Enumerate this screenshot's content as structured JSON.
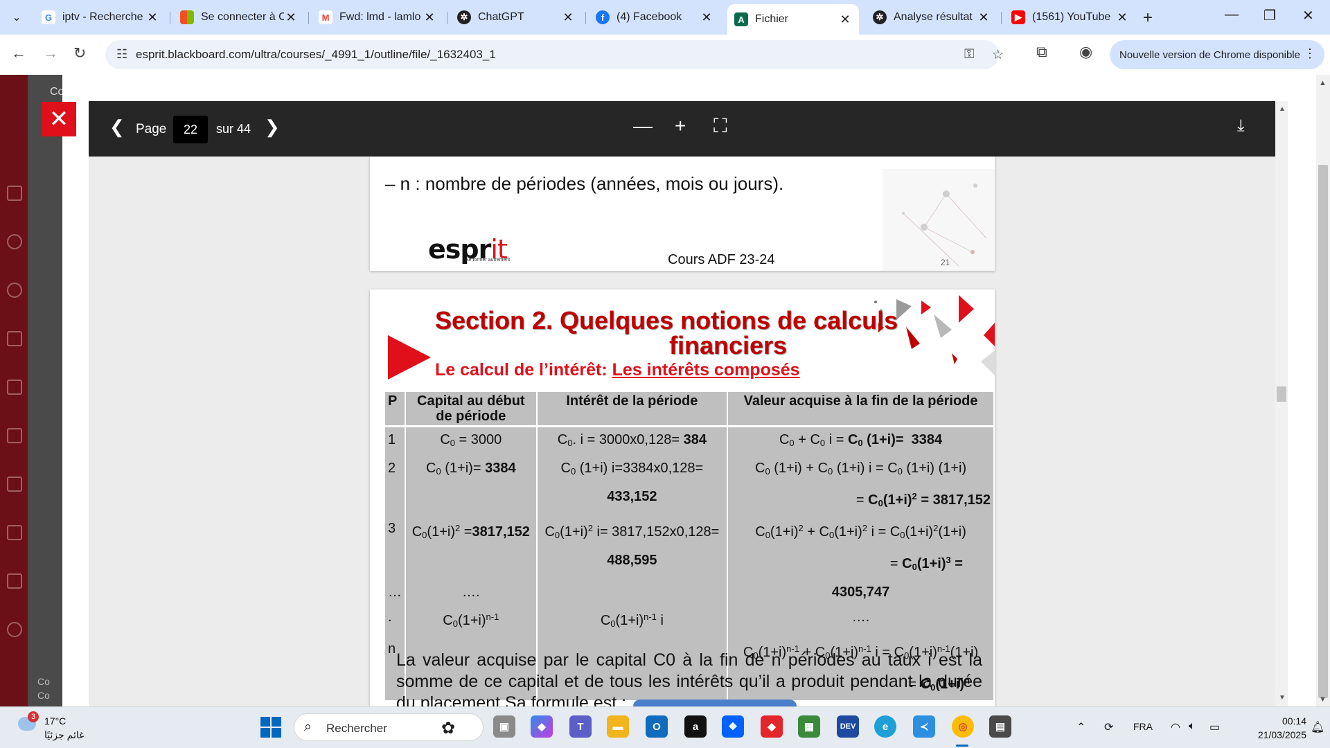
{
  "browser": {
    "tabs": [
      {
        "label": "iptv - Recherche",
        "icon": "google-icon",
        "color": "#ffffff"
      },
      {
        "label": "Se connecter à C",
        "icon": "microsoft-icon",
        "color": "#f25022"
      },
      {
        "label": "Fwd: lmd - lamlo",
        "icon": "gmail-icon",
        "color": "#ea4335"
      },
      {
        "label": "ChatGPT",
        "icon": "openai-icon",
        "color": "#202123"
      },
      {
        "label": "(4) Facebook",
        "icon": "facebook-icon",
        "color": "#1877f2"
      },
      {
        "label": "Fichier",
        "icon": "blackboard-icon",
        "color": "#0a6b4c"
      },
      {
        "label": "Analyse résultat",
        "icon": "openai-icon",
        "color": "#202123"
      },
      {
        "label": "(1561) YouTube",
        "icon": "youtube-icon",
        "color": "#ff0000"
      }
    ],
    "url": "esprit.blackboard.com/ultra/courses/_4991_1/outline/file/_1632403_1",
    "update_label": "Nouvelle version de Chrome disponible"
  },
  "sidebar": {
    "course_prefix": "Co",
    "bottom_1": "Co",
    "bottom_2": "Co"
  },
  "viewer": {
    "page_label": "Page",
    "current_page": "22",
    "total_label": "sur 44"
  },
  "slide1": {
    "bullet": "–   n : nombre de périodes (années, mois ou jours).",
    "logo_main": "espr",
    "logo_accent": "it",
    "logo_tagline": "Se former autrement",
    "footer": "Cours ADF 23-24",
    "number": "21"
  },
  "slide2": {
    "title_line1": "Section 2. Quelques notions de calculs",
    "title_line2": "financiers",
    "subtitle_prefix": "Le calcul de l’intérêt: ",
    "subtitle_link": "Les intérêts composés",
    "table": {
      "headers": [
        "P",
        "Capital au début de période",
        "Intérêt de la période",
        "Valeur acquise à la fin de la période"
      ]
    },
    "paragraph": "La valeur acquise par le capital C0 à la fin de n périodes au taux i est la somme de ce capital et de  tous les intérêts qu’il a produit pendant la durée du placement Sa formule est :"
  },
  "taskbar": {
    "temperature": "17°C",
    "weather": "غائم جزئيًا",
    "weather_badge": "3",
    "search_placeholder": "Rechercher",
    "language": "FRA",
    "time": "00:14",
    "date": "21/03/2025"
  },
  "colors": {
    "accent_red": "#e0101a",
    "title_red": "#c00000",
    "table_gray": "#bfbfbf",
    "blackboard_maroon": "#6b1017"
  }
}
